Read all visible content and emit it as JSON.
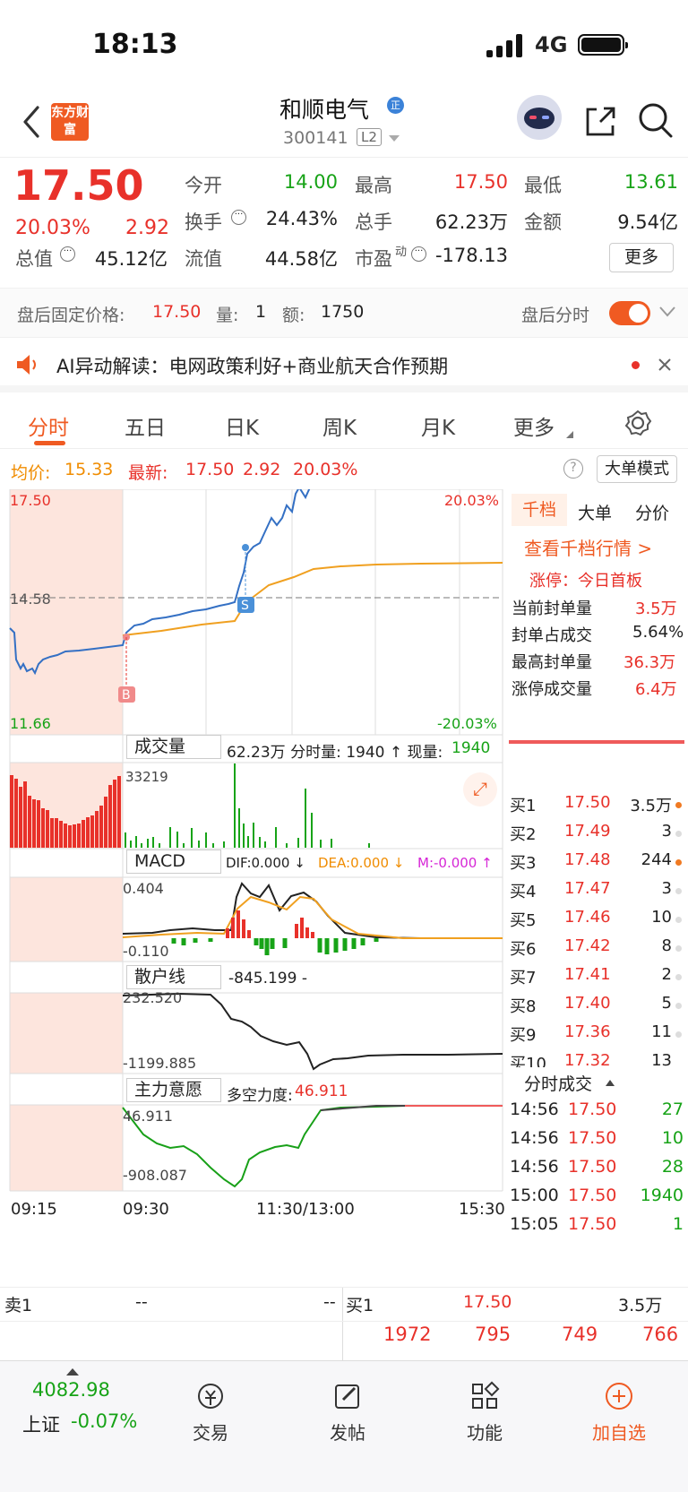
{
  "status": {
    "time": "18:13",
    "network": "4G"
  },
  "nav": {
    "logo_text": "东方财富",
    "stock_name": "和顺电气",
    "badge": "正",
    "code": "300141",
    "level": "L2"
  },
  "quote": {
    "price": "17.50",
    "change_pct": "20.03%",
    "change_amt": "2.92",
    "open_label": "今开",
    "open": "14.00",
    "high_label": "最高",
    "high": "17.50",
    "low_label": "最低",
    "low": "13.61",
    "turnover_label": "换手",
    "turnover": "24.43%",
    "volume_label": "总手",
    "volume": "62.23万",
    "amount_label": "金额",
    "amount": "9.54亿",
    "mcap_label": "总值",
    "mcap": "45.12亿",
    "float_label": "流值",
    "float": "44.58亿",
    "pe_label": "市盈",
    "pe_dynamic": "动",
    "pe": "-178.13",
    "more": "更多"
  },
  "after_hours": {
    "price_label": "盘后固定价格:",
    "price": "17.50",
    "volume_label": "量:",
    "volume": "1",
    "amount_label": "额:",
    "amount": "1750",
    "split_label": "盘后分时"
  },
  "ai": {
    "text": "AI异动解读：电网政策利好+商业航天合作预期"
  },
  "tabs": [
    "分时",
    "五日",
    "日K",
    "周K",
    "月K",
    "更多"
  ],
  "avg": {
    "avg_label": "均价:",
    "avg_value": "15.33",
    "latest_label": "最新:",
    "latest": "17.50",
    "chg": "2.92",
    "pct": "20.03%",
    "mode": "大单模式"
  },
  "chart": {
    "labels": {
      "top_price": "17.50",
      "mid_price": "14.58",
      "low_price": "11.66",
      "top_pct": "20.03%",
      "low_pct": "-20.03%",
      "buy": "B",
      "sell": "S"
    },
    "volume": {
      "selector": "成交量",
      "info": "62.23万 分时量: 1940 ↑ 现量: ",
      "current": "1940",
      "max": "33219"
    },
    "macd": {
      "selector": "MACD",
      "dif": "DIF:0.000 ↓",
      "dea": "DEA:0.000 ↓",
      "m": "M:-0.000 ↑",
      "top": "0.404",
      "bottom": "-0.110"
    },
    "retail": {
      "selector": "散户线",
      "value": "-845.199 -",
      "top": "232.520",
      "bottom": "-1199.885"
    },
    "main": {
      "selector": "主力意愿",
      "strength_label": "多空力度:",
      "strength": "46.911",
      "top": "46.911",
      "bottom": "-908.087"
    },
    "times": [
      "09:15",
      "09:30",
      "11:30/13:00",
      "15:30"
    ]
  },
  "right": {
    "tabs": [
      "千档",
      "大单",
      "分价"
    ],
    "view_link": "查看千档行情 >",
    "limit_label": "涨停：今日首板",
    "stats": [
      {
        "label": "当前封单量",
        "value": "3.5万"
      },
      {
        "label": "封单占成交",
        "value": "5.64%"
      },
      {
        "label": "最高封单量",
        "value": "36.3万"
      },
      {
        "label": "涨停成交量",
        "value": "6.4万"
      }
    ],
    "book": [
      {
        "label": "买1",
        "price": "17.50",
        "vol": "3.5万"
      },
      {
        "label": "买2",
        "price": "17.49",
        "vol": "3"
      },
      {
        "label": "买3",
        "price": "17.48",
        "vol": "244"
      },
      {
        "label": "买4",
        "price": "17.47",
        "vol": "3"
      },
      {
        "label": "买5",
        "price": "17.46",
        "vol": "10"
      },
      {
        "label": "买6",
        "price": "17.42",
        "vol": "8"
      },
      {
        "label": "买7",
        "price": "17.41",
        "vol": "2"
      },
      {
        "label": "买8",
        "price": "17.40",
        "vol": "5"
      },
      {
        "label": "买9",
        "price": "17.36",
        "vol": "11"
      },
      {
        "label": "买10",
        "price": "17.32",
        "vol": "13"
      }
    ],
    "deals_title": "分时成交",
    "deals": [
      {
        "time": "14:56",
        "price": "17.50",
        "vol": "27"
      },
      {
        "time": "14:56",
        "price": "17.50",
        "vol": "10"
      },
      {
        "time": "14:56",
        "price": "17.50",
        "vol": "28"
      },
      {
        "time": "15:00",
        "price": "17.50",
        "vol": "1940"
      },
      {
        "time": "15:05",
        "price": "17.50",
        "vol": "1"
      }
    ]
  },
  "bottom_book": {
    "sell_label": "卖1",
    "sell_a": "--",
    "sell_b": "--",
    "buy_label": "买1",
    "buy_price": "17.50",
    "buy_vol": "3.5万",
    "queue": [
      "1972",
      "795",
      "749",
      "766"
    ]
  },
  "tabbar": {
    "index_value": "4082.98",
    "index_name": "上证",
    "index_change": "-0.07%",
    "trade": "交易",
    "post": "发帖",
    "func": "功能",
    "add": "加自选"
  }
}
